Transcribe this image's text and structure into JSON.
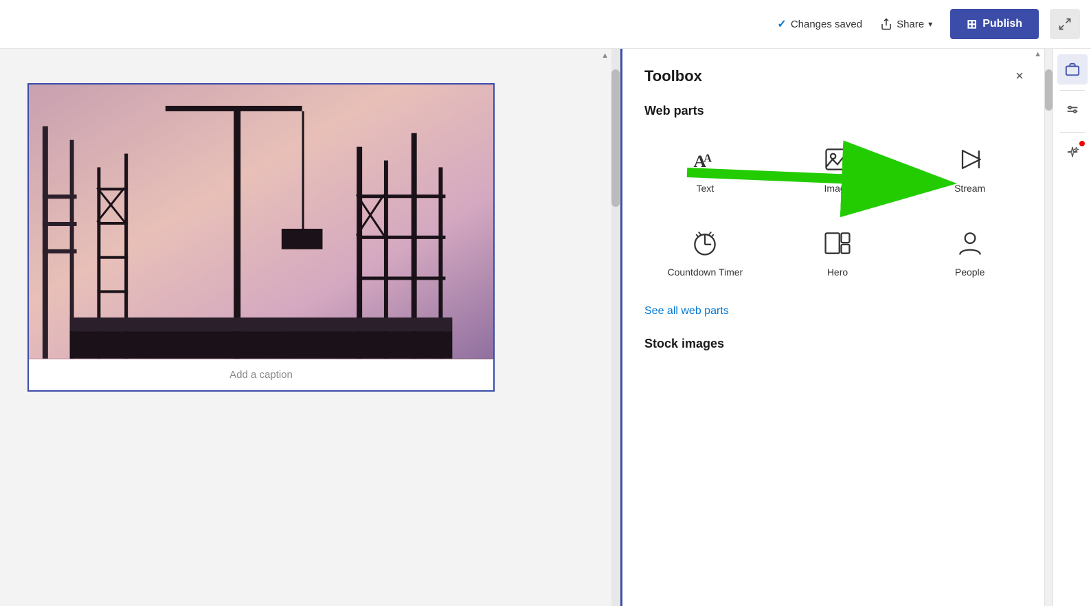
{
  "topbar": {
    "changes_saved_label": "Changes saved",
    "share_label": "Share",
    "publish_label": "Publish"
  },
  "toolbox": {
    "title": "Toolbox",
    "close_icon": "×",
    "web_parts_section": "Web parts",
    "see_all_label": "See all web parts",
    "stock_images_label": "Stock images",
    "web_parts": [
      {
        "id": "text",
        "label": "Text"
      },
      {
        "id": "image",
        "label": "Image"
      },
      {
        "id": "stream",
        "label": "Stream"
      },
      {
        "id": "countdown",
        "label": "Countdown Timer"
      },
      {
        "id": "hero",
        "label": "Hero"
      },
      {
        "id": "people",
        "label": "People"
      }
    ]
  },
  "canvas": {
    "caption_placeholder": "Add a caption"
  }
}
